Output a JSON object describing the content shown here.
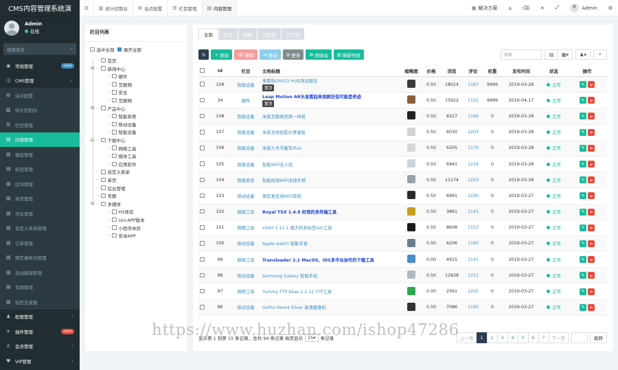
{
  "app": {
    "title": "CMS内容管理系统演"
  },
  "user": {
    "name": "Admin",
    "status": "在线"
  },
  "sidebar": {
    "search_placeholder": "搜索菜单",
    "items": [
      {
        "icon": "dashboard-icon",
        "glyph": "◉",
        "label": "常规管理",
        "badge": "new",
        "badge_color": "blue",
        "type": "group"
      },
      {
        "icon": "cms-icon",
        "glyph": "◫",
        "label": "CMS管理",
        "chevron": "⌄",
        "type": "group"
      },
      {
        "icon": "gear-icon",
        "glyph": "⚙",
        "label": "站点配置",
        "type": "sub"
      },
      {
        "icon": "chart-icon",
        "glyph": "▥",
        "label": "统计控制台",
        "type": "sub"
      },
      {
        "icon": "list-icon",
        "glyph": "☰",
        "label": "栏目管理",
        "type": "sub"
      },
      {
        "icon": "file-icon",
        "glyph": "▤",
        "label": "内容管理",
        "type": "active"
      },
      {
        "icon": "file-icon",
        "glyph": "▤",
        "label": "模型管理",
        "type": "sub"
      },
      {
        "icon": "file-icon",
        "glyph": "▤",
        "label": "标签管理",
        "type": "sub"
      },
      {
        "icon": "file-icon",
        "glyph": "▤",
        "label": "区块管理",
        "type": "sub"
      },
      {
        "icon": "file-icon",
        "glyph": "▤",
        "label": "单页管理",
        "type": "sub"
      },
      {
        "icon": "file-icon",
        "glyph": "▤",
        "label": "评论管理",
        "type": "sub"
      },
      {
        "icon": "file-icon",
        "glyph": "▤",
        "label": "自定义表单管理",
        "type": "sub"
      },
      {
        "icon": "file-icon",
        "glyph": "▤",
        "label": "订单管理",
        "type": "sub"
      },
      {
        "icon": "file-icon",
        "glyph": "▤",
        "label": "预定義样式管理",
        "type": "sub"
      },
      {
        "icon": "file-icon",
        "glyph": "▤",
        "label": "自动链接管理",
        "type": "sub"
      },
      {
        "icon": "file-icon",
        "glyph": "▤",
        "label": "专题管理",
        "type": "sub"
      },
      {
        "icon": "file-icon",
        "glyph": "▤",
        "label": "标签生成器",
        "type": "sub"
      },
      {
        "icon": "admin-icon",
        "glyph": "♟",
        "label": "权限管理",
        "chevron": "‹",
        "type": "group"
      },
      {
        "icon": "plugin-icon",
        "glyph": "✈",
        "label": "插件管理",
        "badge": "new",
        "badge_color": "red",
        "type": "group"
      },
      {
        "icon": "member-icon",
        "glyph": "♙",
        "label": "会员管理",
        "chevron": "‹",
        "type": "group"
      },
      {
        "icon": "vip-icon",
        "glyph": "♥",
        "label": "VIP管理",
        "chevron": "‹",
        "type": "group"
      }
    ]
  },
  "topbar": {
    "tabs": [
      {
        "icon": "chart-icon",
        "glyph": "▥",
        "label": "统计控制台"
      },
      {
        "icon": "gear-icon",
        "glyph": "⚙",
        "label": "站点配置"
      },
      {
        "icon": "list-icon",
        "glyph": "☰",
        "label": "栏目管理"
      },
      {
        "icon": "file-icon",
        "glyph": "▤",
        "label": "内容管理",
        "active": true
      }
    ],
    "right_label": "解决方案",
    "user_name": "Admin"
  },
  "tree": {
    "title": "栏目列表",
    "select_all": "选中全部",
    "expand_all": "展开全部",
    "nodes": [
      {
        "label": "首页",
        "level": 0,
        "toggle": ""
      },
      {
        "label": "新闻中心",
        "level": 0,
        "toggle": "⊟"
      },
      {
        "label": "硬件",
        "level": 1
      },
      {
        "label": "互联网",
        "level": 1
      },
      {
        "label": "安全",
        "level": 1
      },
      {
        "label": "互联网",
        "level": 1
      },
      {
        "label": "产品中心",
        "level": 0,
        "toggle": "⊟"
      },
      {
        "label": "智能家居",
        "level": 1
      },
      {
        "label": "移动设备",
        "level": 1
      },
      {
        "label": "智能设备",
        "level": 1
      },
      {
        "label": "下载中心",
        "level": 0,
        "toggle": "⊟"
      },
      {
        "label": "网络工具",
        "level": 1
      },
      {
        "label": "媒体工具",
        "level": 1
      },
      {
        "label": "应用软件",
        "level": 1
      },
      {
        "label": "自定义表单",
        "level": 0,
        "toggle": ""
      },
      {
        "label": "单页",
        "level": 0,
        "toggle": ""
      },
      {
        "label": "后台管理",
        "level": 0,
        "toggle": ""
      },
      {
        "label": "专题",
        "level": 0,
        "toggle": ""
      },
      {
        "label": "多媒体",
        "level": 0,
        "toggle": "⊟"
      },
      {
        "label": "H5体验",
        "level": 1
      },
      {
        "label": "Uni-APP版本",
        "level": 1
      },
      {
        "label": "小程序体验",
        "level": 1
      },
      {
        "label": "安卓APP",
        "level": 1
      }
    ]
  },
  "content_tabs": [
    "全部",
    "正常",
    "隐藏",
    "已拒绝",
    "已下线"
  ],
  "toolbar": {
    "refresh_glyph": "↻",
    "add": "添加",
    "delete": "删除",
    "move": "移动",
    "more": "更多",
    "recycle": "回收站",
    "refresh_list": "刷新列表",
    "search_placeholder": "搜索"
  },
  "table": {
    "headers": [
      "Id",
      "栏目",
      "文档标题",
      "缩略图",
      "价格",
      "浏览",
      "评论",
      "权重",
      "发布时间",
      "状态",
      "操作"
    ],
    "rows": [
      {
        "id": "109",
        "channel": "智能设备",
        "title": "来看科ORICO HUB测试报告",
        "tag": "置顶",
        "style": "link",
        "thumb": "#3a3a3a",
        "price": "0.50",
        "views": "18014",
        "comments": "1167",
        "weight": "9999",
        "date": "2019-03-28",
        "status": "正常"
      },
      {
        "id": "34",
        "channel": "硬件",
        "title": "Leap Motion AR头显看起来很疯狂但可能是奇迹",
        "tag": "置顶",
        "style": "bold",
        "thumb": "#8a6040",
        "price": "0.50",
        "views": "15622",
        "comments": "1152",
        "weight": "9999",
        "date": "2016-04-17",
        "status": "正常"
      },
      {
        "id": "108",
        "channel": "智能设备",
        "title": "米家互联网洗烘一体机",
        "tag": "",
        "style": "link",
        "thumb": "#222222",
        "price": "0.50",
        "views": "8327",
        "comments": "1166",
        "weight": "0",
        "date": "2019-03-28",
        "status": "正常"
      },
      {
        "id": "107",
        "channel": "智能设备",
        "title": "米家无线投影仪青春版",
        "tag": "",
        "style": "link",
        "thumb": "#cfd3d6",
        "price": "0.50",
        "views": "6030",
        "comments": "1203",
        "weight": "0",
        "date": "2019-03-28",
        "status": "正常"
      },
      {
        "id": "106",
        "channel": "智能设备",
        "title": "米家九号平衡车Plus",
        "tag": "",
        "style": "link",
        "thumb": "#d7d7d7",
        "price": "0.50",
        "views": "6305",
        "comments": "1170",
        "weight": "0",
        "date": "2019-03-28",
        "status": "正常"
      },
      {
        "id": "105",
        "channel": "智能设备",
        "title": "智能WiFi无人机",
        "tag": "",
        "style": "link",
        "thumb": "#c9d4dc",
        "price": "0.50",
        "views": "6941",
        "comments": "1219",
        "weight": "0",
        "date": "2019-03-28",
        "status": "正常"
      },
      {
        "id": "104",
        "channel": "智能家居",
        "title": "智能探球WiFi无线手柄",
        "tag": "",
        "style": "link",
        "thumb": "#9aa0a8",
        "price": "0.50",
        "views": "11174",
        "comments": "1253",
        "weight": "0",
        "date": "2019-03-28",
        "status": "正常"
      },
      {
        "id": "103",
        "channel": "移动设备",
        "title": "索尼真无线WiFi耳机",
        "tag": "",
        "style": "link",
        "thumb": "#2a2a2a",
        "price": "0.50",
        "views": "6991",
        "comments": "1190",
        "weight": "0",
        "date": "2019-03-27",
        "status": "正常"
      },
      {
        "id": "102",
        "channel": "网络工具",
        "title": "Royal TSX 1.4.8 好用的多终端工具",
        "tag": "",
        "style": "bold",
        "thumb": "#c8a020",
        "price": "0.50",
        "views": "3861",
        "comments": "1143",
        "weight": "0",
        "date": "2019-03-27",
        "status": "正常"
      },
      {
        "id": "101",
        "channel": "网络工具",
        "title": "xSSH 1.11.1 强大的多标签ssh工具",
        "tag": "",
        "style": "link",
        "thumb": "#1a1a1a",
        "price": "0.50",
        "views": "8608",
        "comments": "1153",
        "weight": "0",
        "date": "2019-03-27",
        "status": "正常"
      },
      {
        "id": "100",
        "channel": "移动设备",
        "title": "Apple watch 智能手表",
        "tag": "",
        "style": "link",
        "thumb": "#6a8090",
        "price": "0.50",
        "views": "6206",
        "comments": "1160",
        "weight": "0",
        "date": "2019-03-27",
        "status": "正常"
      },
      {
        "id": "99",
        "channel": "网络工具",
        "title": "Transloader 2.1 MacOS、iOS多平台协作的下载工具",
        "tag": "",
        "style": "bold",
        "thumb": "#4a90c8",
        "price": "0.00",
        "views": "4915",
        "comments": "1141",
        "weight": "0",
        "date": "2019-03-27",
        "status": "正常"
      },
      {
        "id": "98",
        "channel": "移动设备",
        "title": "Samsung Galaxy 智能手机",
        "tag": "",
        "style": "link",
        "thumb": "#b0b8c0",
        "price": "0.50",
        "views": "12838",
        "comments": "1211",
        "weight": "0",
        "date": "2019-03-27",
        "status": "正常"
      },
      {
        "id": "97",
        "channel": "网络工具",
        "title": "Yummy FTP Alias 2.2.12 FTP工具",
        "tag": "",
        "style": "link",
        "thumb": "#2eaa50",
        "price": "0.00",
        "views": "2561",
        "comments": "1205",
        "weight": "0",
        "date": "2019-03-27",
        "status": "正常"
      },
      {
        "id": "96",
        "channel": "移动设备",
        "title": "GoPro Hero4 Silver 高清摄像机",
        "tag": "",
        "style": "link",
        "thumb": "#333333",
        "price": "0.50",
        "views": "7086",
        "comments": "1160",
        "weight": "0",
        "date": "2019-03-27",
        "status": "正常"
      }
    ]
  },
  "pager": {
    "summary_a": "显示第 1 到第 15 条记录，总共 94 条记录 每页显示",
    "page_size": "15",
    "summary_b": "条记录",
    "prev": "上一页",
    "pages": [
      "1",
      "2",
      "3",
      "4",
      "5",
      "6",
      "7"
    ],
    "next": "下一页",
    "jump": "跳转"
  },
  "watermark": "https://www.huzhan.com/ishop47286"
}
